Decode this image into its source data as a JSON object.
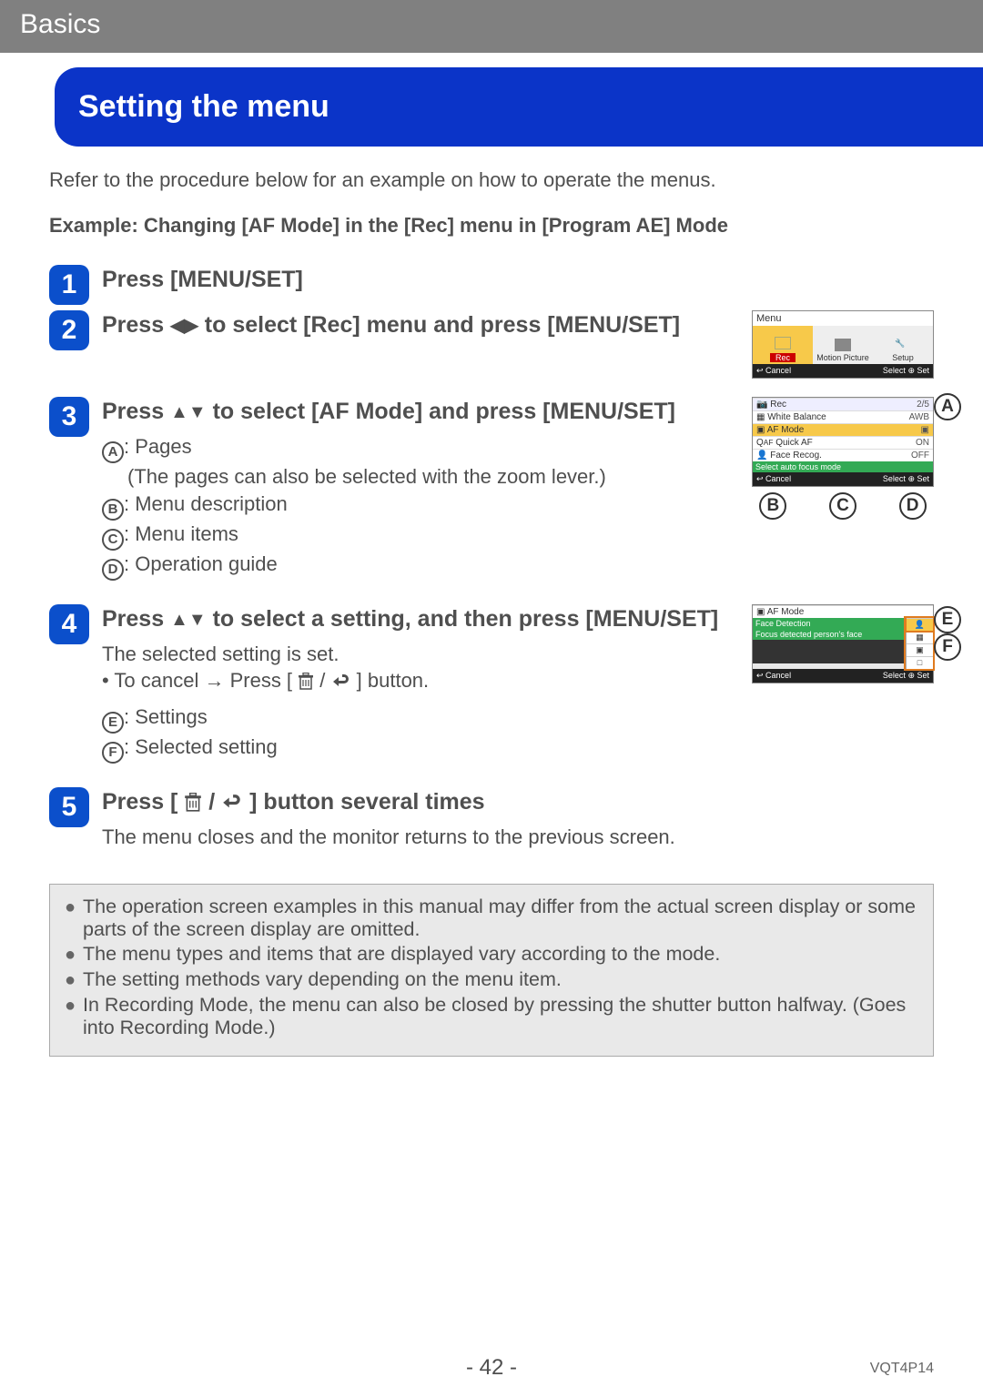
{
  "header": {
    "section": "Basics"
  },
  "title": "Setting the menu",
  "intro": "Refer to the procedure below for an example on how to operate the menus.",
  "example": "Example: Changing [AF Mode] in the [Rec] menu in [Program AE] Mode",
  "steps": {
    "s1": {
      "num": "1",
      "title": "Press [MENU/SET]"
    },
    "s2": {
      "num": "2",
      "title_a": "Press ",
      "title_b": " to select [Rec] menu and press [MENU/SET]"
    },
    "s3": {
      "num": "3",
      "title_a": "Press ",
      "title_b": " to select [AF Mode] and press [MENU/SET]",
      "a_label": ": Pages",
      "a_sub": "(The pages can also be selected with the zoom lever.)",
      "b_label": ": Menu description",
      "c_label": ": Menu items",
      "d_label": ": Operation guide"
    },
    "s4": {
      "num": "4",
      "title_a": "Press ",
      "title_b": " to select a setting, and then press [MENU/SET]",
      "line1": "The selected setting is set.",
      "line2_a": "• To cancel → Press [",
      "line2_b": " / ",
      "line2_c": "] button.",
      "e_label": ": Settings",
      "f_label": ": Selected setting"
    },
    "s5": {
      "num": "5",
      "title_a": "Press [",
      "title_b": " / ",
      "title_c": "] button several times",
      "body": "The menu closes and the monitor returns to the previous screen."
    }
  },
  "shot1": {
    "menu": "Menu",
    "tab1": "Rec",
    "tab2": "Motion Picture",
    "tab3": "Setup",
    "cancel": "Cancel",
    "select": "Select",
    "set": "Set"
  },
  "shot2": {
    "head": "Rec",
    "page": "2/5",
    "r1": "White Balance",
    "v1": "AWB",
    "r2": "AF Mode",
    "v2": "",
    "r3": "Quick AF",
    "v3": "ON",
    "r4": "Face Recog.",
    "v4": "OFF",
    "hint": "Select auto focus mode",
    "cancel": "Cancel",
    "select": "Select",
    "set": "Set"
  },
  "shot3": {
    "head": "AF Mode",
    "t1": "Face Detection",
    "t2": "Focus detected person's face",
    "cancel": "Cancel",
    "select": "Select",
    "set": "Set"
  },
  "callout": {
    "A": "A",
    "B": "B",
    "C": "C",
    "D": "D",
    "E": "E",
    "F": "F"
  },
  "notes": {
    "n1": "The operation screen examples in this manual may differ from the actual screen display or some parts of the screen display are omitted.",
    "n2": "The menu types and items that are displayed vary according to the mode.",
    "n3": "The setting methods vary depending on the menu item.",
    "n4": "In Recording Mode, the menu can also be closed by pressing the shutter button halfway. (Goes into Recording Mode.)"
  },
  "footer": {
    "page": "- 42 -",
    "doc_id": "VQT4P14"
  }
}
